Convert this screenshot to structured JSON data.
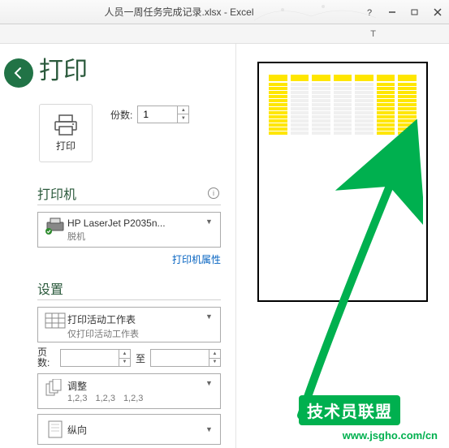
{
  "titlebar": {
    "filename": "人员一周任务完成记录.xlsx - Excel",
    "quick_label": "T"
  },
  "page": {
    "title": "打印"
  },
  "print": {
    "button_label": "打印",
    "copies_label": "份数:",
    "copies_value": "1"
  },
  "printer": {
    "section_title": "打印机",
    "name": "HP LaserJet P2035n...",
    "status": "脱机",
    "properties_link": "打印机属性"
  },
  "settings": {
    "section_title": "设置",
    "scope_main": "打印活动工作表",
    "scope_sub": "仅打印活动工作表",
    "pages_label": "页数:",
    "pages_to": "至",
    "collate_main": "调整",
    "collate_sub1": "1,2,3",
    "collate_sub2": "1,2,3",
    "collate_sub3": "1,2,3",
    "orientation": "纵向"
  },
  "watermark": {
    "badge": "技术员联盟",
    "url": "www.jsgho.com/cn"
  }
}
